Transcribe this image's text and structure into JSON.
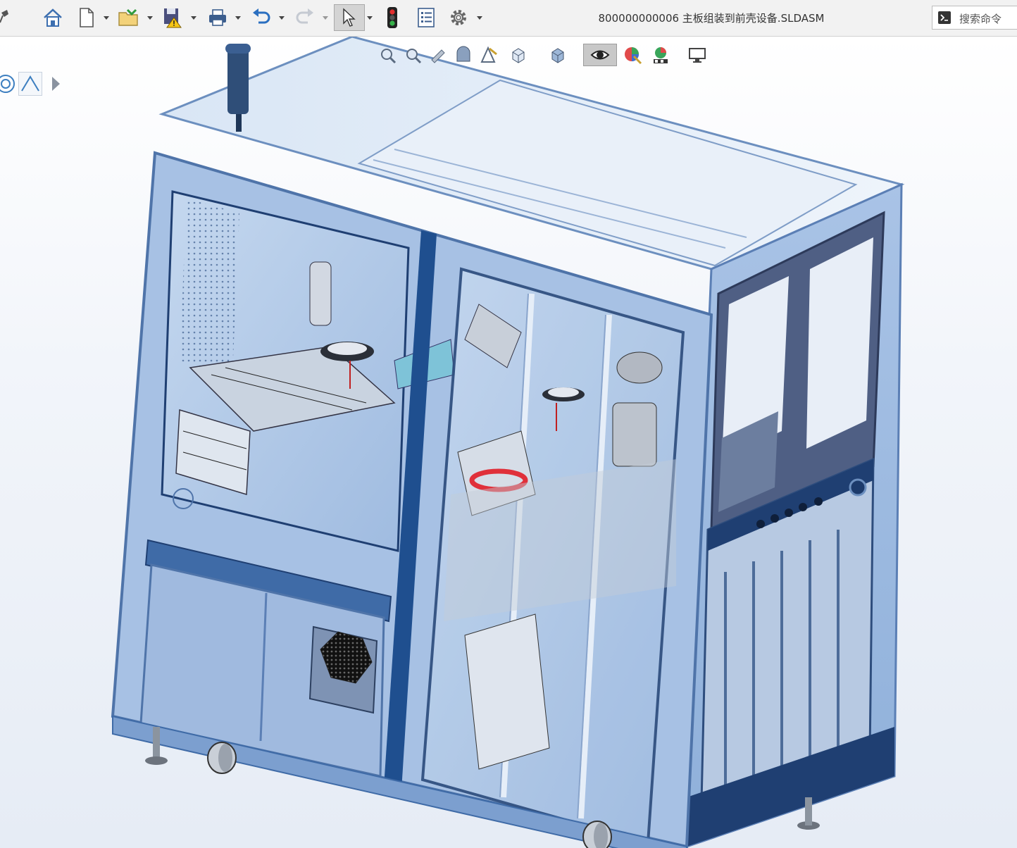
{
  "window": {
    "document_title": "800000000006 主板组装到前壳设备.SLDASM"
  },
  "toolbar": {
    "items": [
      {
        "name": "home-button",
        "icon": "home-icon"
      },
      {
        "name": "new-document-button",
        "icon": "new-document-icon"
      },
      {
        "name": "open-button",
        "icon": "open-folder-icon"
      },
      {
        "name": "save-button",
        "icon": "save-warning-icon"
      },
      {
        "name": "print-button",
        "icon": "printer-icon"
      },
      {
        "name": "undo-button",
        "icon": "undo-icon"
      },
      {
        "name": "redo-button",
        "icon": "redo-icon"
      },
      {
        "name": "select-button",
        "icon": "cursor-icon"
      },
      {
        "name": "rebuild-button",
        "icon": "traffic-light-icon"
      },
      {
        "name": "file-properties-button",
        "icon": "properties-list-icon"
      },
      {
        "name": "options-button",
        "icon": "gear-icon"
      }
    ]
  },
  "search": {
    "placeholder": "搜索命令"
  },
  "heads_up_toolbar": {
    "items": [
      {
        "name": "zoom-to-fit-button",
        "icon": "zoom-fit-icon"
      },
      {
        "name": "zoom-to-area-button",
        "icon": "zoom-area-icon"
      },
      {
        "name": "previous-view-button",
        "icon": "previous-view-icon"
      },
      {
        "name": "section-view-button",
        "icon": "section-view-icon"
      },
      {
        "name": "dynamic-annotation-button",
        "icon": "annotation-icon"
      },
      {
        "name": "view-orientation-button",
        "icon": "view-orientation-icon"
      },
      {
        "name": "display-style-button",
        "icon": "display-style-icon"
      },
      {
        "name": "hide-show-items-button",
        "icon": "eye-icon"
      },
      {
        "name": "edit-appearance-button",
        "icon": "appearance-icon"
      },
      {
        "name": "apply-scene-button",
        "icon": "scene-icon"
      },
      {
        "name": "view-settings-button",
        "icon": "monitor-icon"
      }
    ]
  },
  "side_tools": {
    "items": [
      {
        "name": "circle-tool",
        "icon": "circle-icon"
      },
      {
        "name": "sketch-tool",
        "icon": "angle-icon"
      }
    ]
  },
  "colors": {
    "frame": "#7fa6d6",
    "frame_dark": "#1f4f8f",
    "glass": "#b9cfe8",
    "panel": "#9ebbe0",
    "toolbar_bg": "#f2f2f2",
    "accent_red": "#e0303a"
  }
}
